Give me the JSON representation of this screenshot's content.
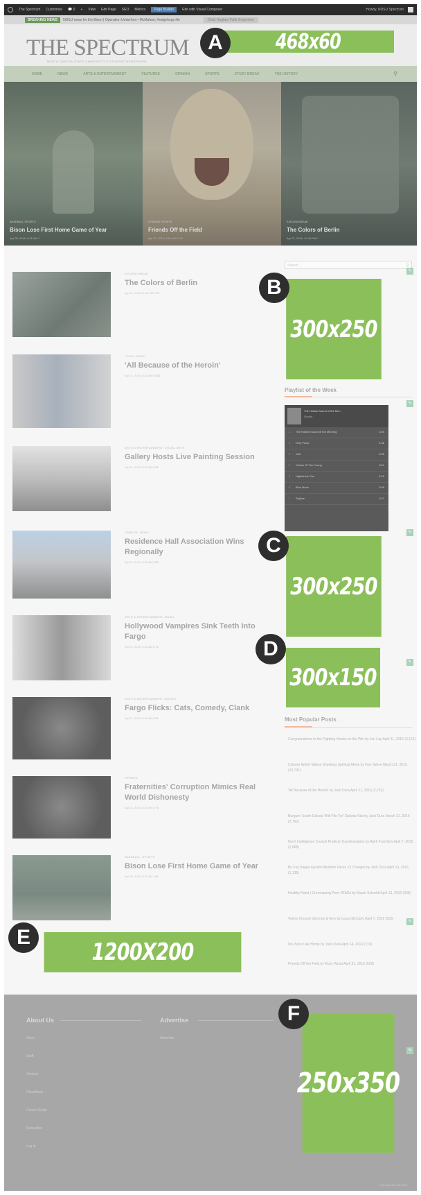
{
  "admin_bar": {
    "site": "The Spectrum",
    "customize": "Customize",
    "comments": "0",
    "new": "+",
    "view": "View",
    "edit_page": "Edit Page",
    "seo": "SEO",
    "pmetrics": "Metrics",
    "highlight": "Page Builder",
    "visual_composer": "Edit with Visual Composer",
    "howdy": "Howdy, NDSU Spectrum"
  },
  "breaking": {
    "tag": "BREAKING NEWS",
    "text": "NDSU news for the Bison | Operation Underfoot  •  McMahan, Hedgehogs No",
    "more": "Chris Hughes Pulls Grapevine"
  },
  "header": {
    "logo": "THE SPECTRUM",
    "tagline": "NORTH DAKOTA STATE UNIVERSITY'S STUDENT NEWSPAPER"
  },
  "nav": {
    "items": [
      "HOME",
      "NEWS",
      "ARTS & ENTERTAINMENT",
      "FEATURES",
      "OPINION",
      "SPORTS",
      "STUDY BREAK",
      "THE HISTORY"
    ],
    "search_icon": "search-icon"
  },
  "hero": [
    {
      "cats": "BASEBALL  SPORTS",
      "title": "Bison Lose First Home Game of Year",
      "meta": "Apr 20, 2016, 8:31 AM  1"
    },
    {
      "cats": "OPINION  SPORTS",
      "title": "Friends Off the Field",
      "meta": "Apr 21, 2016, 8:51 AM  0  0  0"
    },
    {
      "cats": "A ROOM BREAK",
      "title": "The Colors of Berlin",
      "meta": "Apr 21, 2016, 10:44 PM  0"
    }
  ],
  "articles": [
    {
      "cat": "A ROOM BREAK",
      "title": "The Colors of Berlin",
      "meta": "Apr 21, 2016 10:44 PM",
      "c": "0",
      "v": "97"
    },
    {
      "cat": "LOCAL NEWS",
      "title": "'All Because of the Heroin'",
      "meta": "Apr 21, 2016, 8:31 AM",
      "c": "0",
      "v": "203"
    },
    {
      "cat": "ARTS & ENTERTAINMENT, VISUAL ARTS",
      "title": "Gallery Hosts Live Painting Session",
      "meta": "Apr 21, 2016, 8:31 AM",
      "c": "0",
      "v": "51"
    },
    {
      "cat": "CAMPUS, NEWS",
      "title": "Residence Hall Association Wins Regionally",
      "meta": "Apr 21, 2016, 8:31 AM",
      "c": "0",
      "v": "62"
    },
    {
      "cat": "ARTS & ENTERTAINMENT, MUSIC",
      "title": "Hollywood Vampires Sink Teeth Into Fargo",
      "meta": "Apr 21, 2016, 8:31 AM",
      "c": "0",
      "v": "72"
    },
    {
      "cat": "ARTS & ENTERTAINMENT, MOVIES",
      "title": "Fargo Flicks: Cats, Comedy, Clank",
      "meta": "Apr 21, 2016, 8:31 AM",
      "c": "0",
      "v": "51"
    },
    {
      "cat": "OPINION",
      "title": "Fraternities' Corruption Mimics Real World Dishonesty",
      "meta": "Apr 21, 2016, 8:31 AM",
      "c": "0",
      "v": "75"
    },
    {
      "cat": "BASEBALL, SPORTS",
      "title": "Bison Lose First Home Game of Year",
      "meta": "Apr 20, 2016, 8:31 AM",
      "c": "1",
      "v": "81"
    }
  ],
  "sidebar": {
    "search_placeholder": "Search ...",
    "playlist_title": "Playlist of the Week",
    "playlist_head": "The Hollow Sound of the Mor...",
    "playlist_sub": "Spotify",
    "tracks": [
      {
        "n": "1",
        "name": "The Hollow Sound of the Morning",
        "t": "3:00"
      },
      {
        "n": "2",
        "name": "Dirty Paws",
        "t": "4:38"
      },
      {
        "n": "3",
        "name": "Salt",
        "t": "3:05"
      },
      {
        "n": "4",
        "name": "Videos Of The Young",
        "t": "3:21"
      },
      {
        "n": "5",
        "name": "Nightshine Owl",
        "t": "4:03"
      },
      {
        "n": "6",
        "name": "Blue Moon",
        "t": "3:09"
      },
      {
        "n": "7",
        "name": "Skyline",
        "t": "3:47"
      }
    ],
    "popular_title": "Most Popular Posts",
    "popular": [
      "Congratulations to the Fighting Hawks on the Win by Jon Lay April 11, 2016 (3,121)",
      "Coloner Worth Makes Shocking Spiritual Move by Fern Wave March 31, 2016 (10,741)",
      "'All Because of the Heroin' by Jack Dura April 21, 2016 (2,763)",
      "Burgum: South Dakota 'Will Pile For' Dakota Kids by Jack Dura March 21, 2016 (2,760)",
      "Non't Intelligence Council Predicts Transformation by Alyth Froehlich April 7, 2016 (1,968)",
      "Bo Fay Kappa Epsilon Member Faces 12 Charges by Jack Dura April 14, 2016 (1,135)",
      "Healthy Hand | Greenspring Peer: IRADs by Maple Schmidt April 13, 2016 (908)",
      "Voters Choose Gjermun & Amy by Laura McCarty April 7, 2016 (803)",
      "No Place Like Home by Jack Dura April 14, 2016 (710)",
      "Friends Off the Field by Ross Wood April 21, 2016 (603)"
    ]
  },
  "ads": {
    "a": {
      "label": "A",
      "size": "468x60"
    },
    "b": {
      "label": "B",
      "size": "300x250"
    },
    "c": {
      "label": "C",
      "size": "300x250"
    },
    "d": {
      "label": "D",
      "size": "300x150"
    },
    "e": {
      "label": "E",
      "size": "1200X200"
    },
    "f": {
      "label": "F",
      "size": "250x350"
    }
  },
  "footer": {
    "about_title": "About Us",
    "advertise_title": "Advertise",
    "about_links": [
      "Store",
      "Staff",
      "Contact",
      "Classifieds",
      "Career Guide",
      "Subscribe",
      "Log In"
    ],
    "advertise_links": [
      "Advertise"
    ],
    "copyright": "The Spectrum © 2016"
  },
  "colors": {
    "ad_green": "#8bbf5a",
    "marker": "#2e2e2e",
    "nav": "#c3cfbb",
    "footer": "#a7a7a7"
  }
}
